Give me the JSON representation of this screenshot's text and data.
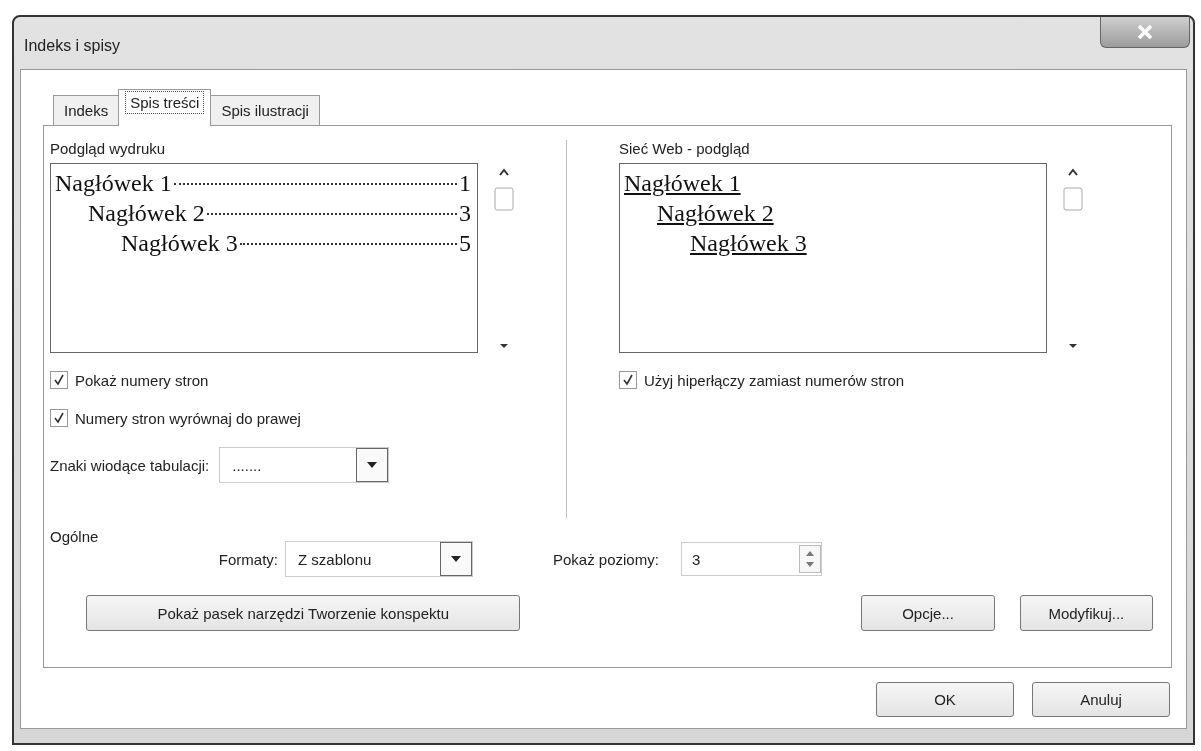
{
  "window": {
    "title": "Indeks i spisy"
  },
  "tabs": [
    {
      "label": "Indeks",
      "selected": false
    },
    {
      "label": "Spis treści",
      "selected": true
    },
    {
      "label": "Spis ilustracji",
      "selected": false
    }
  ],
  "print_preview": {
    "label": "Podgląd wydruku",
    "entries": [
      {
        "text": "Nagłówek 1",
        "page": "1",
        "children": [
          {
            "text": "Nagłówek 2",
            "page": "3",
            "children": [
              {
                "text": "Nagłówek 3",
                "page": "5"
              }
            ]
          }
        ]
      }
    ]
  },
  "web_preview": {
    "label": "Sieć Web - podgląd",
    "entries": [
      {
        "text": "Nagłówek 1",
        "children": [
          {
            "text": "Nagłówek 2",
            "children": [
              {
                "text": "Nagłówek 3"
              }
            ]
          }
        ]
      }
    ]
  },
  "print_options": [
    {
      "label": "Pokaż numery stron",
      "checked": true
    },
    {
      "label": "Numery stron wyrównaj do prawej",
      "checked": true
    }
  ],
  "web_options": [
    {
      "label": "Użyj hiperłączy zamiast numerów stron",
      "checked": true
    }
  ],
  "tab_leader": {
    "label": "Znaki wiodące tabulacji:",
    "value": "......."
  },
  "general": {
    "label": "Ogólne",
    "formats": {
      "label": "Formaty:",
      "value": "Z szablonu"
    },
    "levels": {
      "label": "Pokaż poziomy:",
      "value": "3"
    }
  },
  "panel_buttons": [
    "Pokaż pasek narzędzi Tworzenie konspektu",
    "Opcje...",
    "Modyfikuj..."
  ],
  "dialog_buttons": [
    "OK",
    "Anuluj"
  ]
}
